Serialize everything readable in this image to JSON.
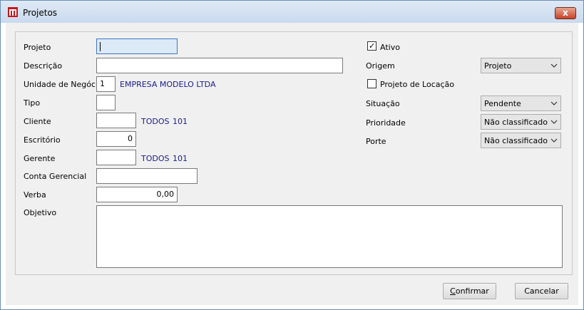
{
  "window": {
    "title": "Projetos",
    "close_label": "x"
  },
  "form": {
    "projeto": {
      "label": "Projeto",
      "value": ""
    },
    "descricao": {
      "label": "Descrição",
      "value": ""
    },
    "unidade": {
      "label": "Unidade de Negócio",
      "value": "1",
      "name": "EMPRESA MODELO LTDA"
    },
    "tipo": {
      "label": "Tipo",
      "value": ""
    },
    "cliente": {
      "label": "Cliente",
      "value": "",
      "name": "TODOS",
      "code": "101"
    },
    "escritorio": {
      "label": "Escritório",
      "value": "0"
    },
    "gerente": {
      "label": "Gerente",
      "value": "",
      "name": "TODOS",
      "code": "101"
    },
    "conta_gerencial": {
      "label": "Conta Gerencial",
      "value": ""
    },
    "verba": {
      "label": "Verba",
      "value": "0,00"
    },
    "objetivo": {
      "label": "Objetivo",
      "value": ""
    },
    "ativo": {
      "label": "Ativo",
      "checked": true
    },
    "origem": {
      "label": "Origem",
      "value": "Projeto"
    },
    "projeto_locacao": {
      "label": "Projeto de Locação",
      "checked": false
    },
    "situacao": {
      "label": "Situação",
      "value": "Pendente"
    },
    "prioridade": {
      "label": "Prioridade",
      "value": "Não classificado"
    },
    "porte": {
      "label": "Porte",
      "value": "Não classificado"
    }
  },
  "buttons": {
    "confirmar": {
      "first": "C",
      "rest": "onfirmar"
    },
    "cancelar": "Cancelar"
  },
  "icons": {
    "app": "app-logo-icon",
    "chevron": "chevron-down-icon",
    "check": "check-icon"
  },
  "colors": {
    "titlebar": "#c9daee",
    "close": "#c7432a",
    "link_text": "#1a1a8c",
    "focused_input": "#dce9f7"
  }
}
